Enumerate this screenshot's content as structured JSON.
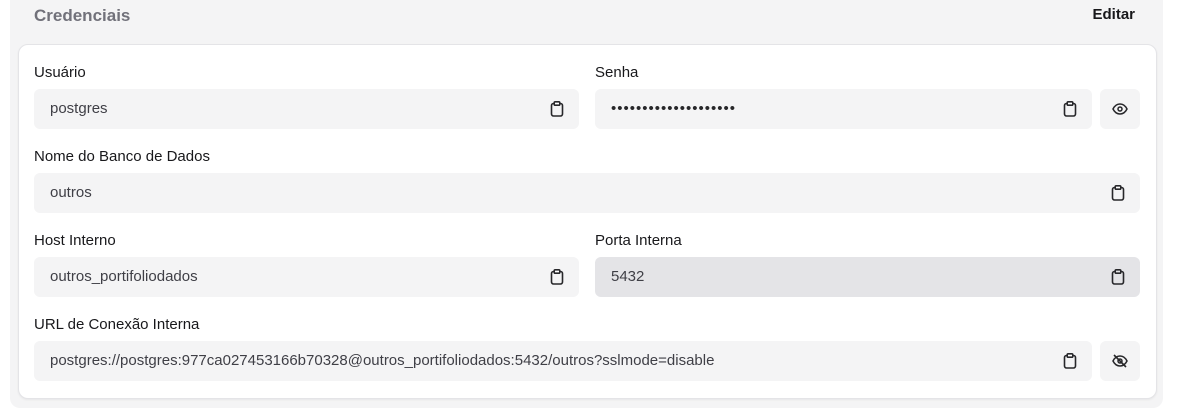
{
  "section": {
    "title": "Credenciais",
    "edit_label": "Editar"
  },
  "fields": {
    "user": {
      "label": "Usuário",
      "value": "postgres"
    },
    "password": {
      "label": "Senha",
      "value": "••••••••••••••••••••"
    },
    "database": {
      "label": "Nome do Banco de Dados",
      "value": "outros"
    },
    "host": {
      "label": "Host Interno",
      "value": "outros_portifoliodados"
    },
    "port": {
      "label": "Porta Interna",
      "value": "5432"
    },
    "url": {
      "label": "URL de Conexão Interna",
      "value": "postgres://postgres:977ca027453166b70328@outros_portifoliodados:5432/outros?sslmode=disable"
    }
  },
  "icons": {
    "copy": "clipboard-icon",
    "show": "eye-icon",
    "hide": "eye-off-icon"
  }
}
